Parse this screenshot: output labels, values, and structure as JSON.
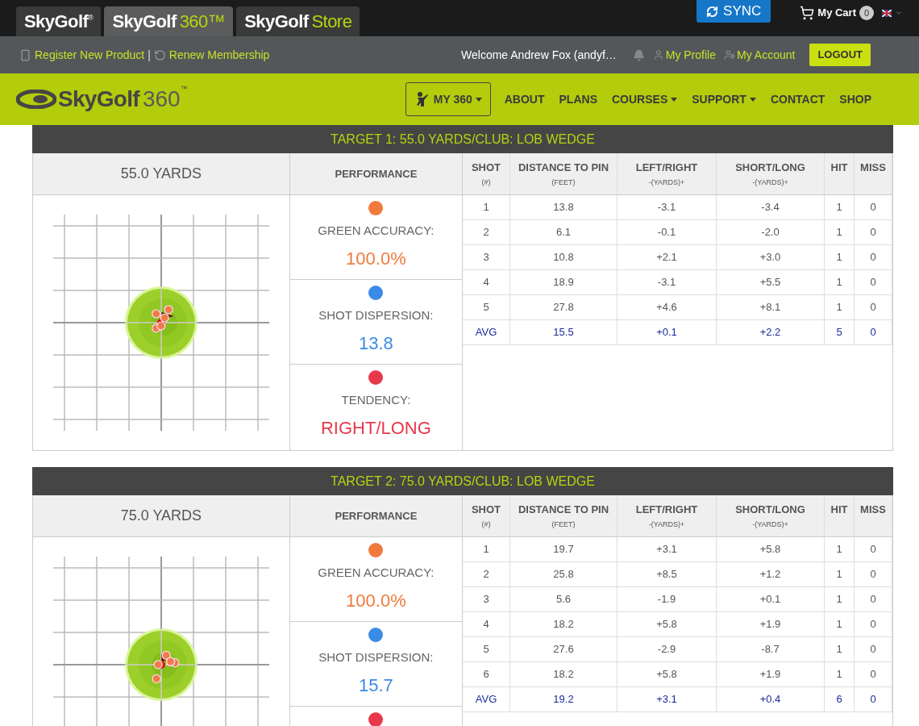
{
  "site_tabs": [
    {
      "brand": "SkyGolf",
      "suffix": "®",
      "selected": false
    },
    {
      "brand": "SkyGolf",
      "suffix": "360™",
      "selected": true
    },
    {
      "brand": "SkyGolf",
      "suffix": "Store",
      "selected": false
    }
  ],
  "sync_button": "SYNC",
  "cart": {
    "label": "My Cart",
    "count": "0"
  },
  "account_bar": {
    "links": [
      {
        "kind": "phone",
        "label": "Register New Product"
      },
      {
        "kind": "refresh",
        "label": "Renew Membership"
      }
    ],
    "separator": "|",
    "welcome": "Welcome Andrew Fox (andyf…",
    "user_links": [
      {
        "kind": "person",
        "label": "My Profile"
      },
      {
        "kind": "account",
        "label": "My Account"
      }
    ],
    "logout": "LOGOUT"
  },
  "logo": {
    "brand": "SkyGolf",
    "suffix": "360",
    "mark": "™"
  },
  "nav": {
    "my360": "MY 360",
    "items": [
      {
        "label": "ABOUT",
        "dropdown": false
      },
      {
        "label": "PLANS",
        "dropdown": false
      },
      {
        "label": "COURSES",
        "dropdown": true
      },
      {
        "label": "SUPPORT",
        "dropdown": true
      },
      {
        "label": "CONTACT",
        "dropdown": false
      },
      {
        "label": "SHOP",
        "dropdown": false
      }
    ]
  },
  "targets": [
    {
      "title": "TARGET 1: 55.0 YARDS/CLUB: LOB WEDGE",
      "distance": "55.0 YARDS",
      "performance_heading": "PERFORMANCE",
      "metrics": [
        {
          "label": "GREEN ACCURACY:",
          "value": "100.0%",
          "color": "#f07a3c"
        },
        {
          "label": "SHOT DISPERSION:",
          "value": "13.8",
          "color": "#3b8ae6"
        },
        {
          "label": "TENDENCY:",
          "value": "RIGHT/LONG",
          "color": "#e8394b"
        }
      ],
      "columns": [
        {
          "title": "SHOT",
          "unit": "(#)"
        },
        {
          "title": "DISTANCE TO PIN",
          "unit": "(FEET)"
        },
        {
          "title": "LEFT/RIGHT",
          "unit": "-(YARDS)+"
        },
        {
          "title": "SHORT/LONG",
          "unit": "-(YARDS)+"
        },
        {
          "title": "HIT"
        },
        {
          "title": "MISS"
        }
      ],
      "rows": [
        {
          "kind": "shot",
          "cells": [
            "1",
            "13.8",
            "-3.1",
            "-3.4",
            "1",
            "0"
          ]
        },
        {
          "kind": "shot",
          "cells": [
            "2",
            "6.1",
            "-0.1",
            "-2.0",
            "1",
            "0"
          ]
        },
        {
          "kind": "shot",
          "cells": [
            "3",
            "10.8",
            "+2.1",
            "+3.0",
            "1",
            "0"
          ]
        },
        {
          "kind": "shot",
          "cells": [
            "4",
            "18.9",
            "-3.1",
            "+5.5",
            "1",
            "0"
          ]
        },
        {
          "kind": "shot",
          "cells": [
            "5",
            "27.8",
            "+4.6",
            "+8.1",
            "1",
            "0"
          ]
        },
        {
          "kind": "avg",
          "cells": [
            "AVG",
            "15.5",
            "+0.1",
            "+2.2",
            "5",
            "0"
          ]
        }
      ]
    },
    {
      "title": "TARGET 2: 75.0 YARDS/CLUB: LOB WEDGE",
      "distance": "75.0 YARDS",
      "performance_heading": "PERFORMANCE",
      "metrics": [
        {
          "label": "GREEN ACCURACY:",
          "value": "100.0%",
          "color": "#f07a3c"
        },
        {
          "label": "SHOT DISPERSION:",
          "value": "15.7",
          "color": "#3b8ae6"
        },
        {
          "color": "#e8394b"
        }
      ],
      "columns": [
        {
          "title": "SHOT",
          "unit": "(#)"
        },
        {
          "title": "DISTANCE TO PIN",
          "unit": "(FEET)"
        },
        {
          "title": "LEFT/RIGHT",
          "unit": "-(YARDS)+"
        },
        {
          "title": "SHORT/LONG",
          "unit": "-(YARDS)+"
        },
        {
          "title": "HIT"
        },
        {
          "title": "MISS"
        }
      ],
      "rows": [
        {
          "kind": "shot",
          "cells": [
            "1",
            "19.7",
            "+3.1",
            "+5.8",
            "1",
            "0"
          ]
        },
        {
          "kind": "shot",
          "cells": [
            "2",
            "25.8",
            "+8.5",
            "+1.2",
            "1",
            "0"
          ]
        },
        {
          "kind": "shot",
          "cells": [
            "3",
            "5.6",
            "-1.9",
            "+0.1",
            "1",
            "0"
          ]
        },
        {
          "kind": "shot",
          "cells": [
            "4",
            "18.2",
            "+5.8",
            "+1.9",
            "1",
            "0"
          ]
        },
        {
          "kind": "shot",
          "cells": [
            "5",
            "27.6",
            "-2.9",
            "-8.7",
            "1",
            "0"
          ]
        },
        {
          "kind": "shot",
          "cells": [
            "6",
            "18.2",
            "+5.8",
            "+1.9",
            "1",
            "0"
          ]
        },
        {
          "kind": "avg",
          "cells": [
            "AVG",
            "19.2",
            "+3.1",
            "+0.4",
            "6",
            "0"
          ]
        }
      ]
    }
  ]
}
